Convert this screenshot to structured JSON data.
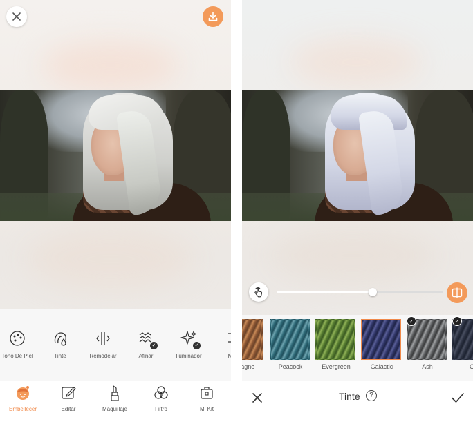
{
  "left_screen": {
    "tools": [
      {
        "label": "Tono De Piel",
        "icon": "palette-icon"
      },
      {
        "label": "Tinte",
        "icon": "hair-tint-icon"
      },
      {
        "label": "Remodelar",
        "icon": "reshape-icon"
      },
      {
        "label": "Afinar",
        "icon": "smooth-icon",
        "badge": true
      },
      {
        "label": "Iluminador",
        "icon": "sparkle-icon",
        "badge": true
      },
      {
        "label": "Ma",
        "icon": "more-tool-icon"
      }
    ],
    "nav": [
      {
        "label": "Embellecer",
        "icon": "face-icon",
        "active": true
      },
      {
        "label": "Editar",
        "icon": "edit-icon",
        "active": false
      },
      {
        "label": "Maquillaje",
        "icon": "lipstick-icon",
        "active": false
      },
      {
        "label": "Filtro",
        "icon": "filter-icon",
        "active": false
      },
      {
        "label": "Mi Kit",
        "icon": "kit-icon",
        "active": false
      }
    ]
  },
  "right_screen": {
    "slider_value": 0.58,
    "swatches": [
      {
        "label": "mpagne",
        "colors": [
          "#6b4329",
          "#c98a57",
          "#8a5533"
        ],
        "selected": false,
        "downloaded": false
      },
      {
        "label": "Peacock",
        "colors": [
          "#1f4f5c",
          "#6ea4b0",
          "#2f6a78"
        ],
        "selected": false,
        "downloaded": false
      },
      {
        "label": "Evergreen",
        "colors": [
          "#3a5a22",
          "#8fb256",
          "#557a30"
        ],
        "selected": false,
        "downloaded": false
      },
      {
        "label": "Galactic",
        "colors": [
          "#1f2448",
          "#5a5f99",
          "#2f3566"
        ],
        "selected": true,
        "downloaded": false
      },
      {
        "label": "Ash",
        "colors": [
          "#3a3b3c",
          "#a0a2a4",
          "#5c5e60"
        ],
        "selected": false,
        "downloaded": true
      },
      {
        "label": "Gr",
        "colors": [
          "#1c2230",
          "#4a5062",
          "#2a3040"
        ],
        "selected": false,
        "downloaded": true
      }
    ],
    "title": "Tinte",
    "help": "?"
  },
  "colors": {
    "accent": "#f08a4b",
    "accent_button": "#f39a5a"
  }
}
